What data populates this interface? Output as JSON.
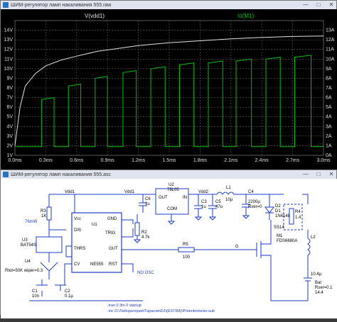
{
  "plot_window": {
    "title": "ШИМ-регулятор ламп накаливания 555.raw",
    "controls": [
      "—",
      "□",
      "✕"
    ],
    "trace_labels": [
      "V(vdd1)",
      "Id(M1)"
    ],
    "colors": {
      "v_trace": "#e0e0e0",
      "i_trace": "#00c000",
      "background": "#000000",
      "grid": "#5a5a5a"
    }
  },
  "chart_data": {
    "type": "line",
    "x_ticks": [
      "0.0ms",
      "0.3ms",
      "0.6ms",
      "0.9ms",
      "1.2ms",
      "1.5ms",
      "1.8ms",
      "2.1ms",
      "2.4ms",
      "2.7ms",
      "3.0ms"
    ],
    "y_left_ticks": [
      "14V",
      "13V",
      "12V",
      "11V",
      "10V",
      "9V",
      "8V",
      "7V",
      "6V",
      "5V",
      "4V",
      "3V",
      "2V",
      "1V"
    ],
    "y_right_ticks": [
      "13A",
      "12A",
      "11A",
      "10A",
      "9A",
      "8A",
      "7A",
      "6A",
      "5A",
      "4A",
      "3A",
      "2A",
      "1A",
      "0A"
    ],
    "x_range_ms": [
      0,
      3.0
    ],
    "y_left_range_v": [
      1,
      14
    ],
    "y_right_range_a": [
      0,
      13
    ],
    "grid": true,
    "series": [
      {
        "name": "V(vdd1)",
        "axis": "left",
        "points": [
          [
            0,
            2
          ],
          [
            0.05,
            6
          ],
          [
            0.1,
            8.2
          ],
          [
            0.2,
            9.5
          ],
          [
            0.3,
            10.3
          ],
          [
            0.45,
            10.9
          ],
          [
            0.6,
            11.3
          ],
          [
            0.8,
            11.8
          ],
          [
            1.0,
            12.1
          ],
          [
            1.2,
            12.4
          ],
          [
            1.5,
            12.7
          ],
          [
            1.8,
            12.9
          ],
          [
            2.1,
            13.1
          ],
          [
            2.4,
            13.25
          ],
          [
            2.7,
            13.35
          ],
          [
            3.0,
            13.4
          ]
        ]
      },
      {
        "name": "Id(M1)",
        "axis": "right",
        "pulses": [
          [
            0.26,
            0.38,
            5.8
          ],
          [
            0.52,
            0.64,
            7.2
          ],
          [
            0.78,
            0.9,
            8.0
          ],
          [
            1.05,
            1.18,
            8.6
          ],
          [
            1.32,
            1.46,
            9.0
          ],
          [
            1.6,
            1.74,
            9.4
          ],
          [
            1.88,
            2.02,
            9.6
          ],
          [
            2.15,
            2.3,
            9.8
          ],
          [
            2.44,
            2.58,
            10.0
          ],
          [
            2.72,
            2.88,
            10.2
          ]
        ],
        "baseline": 0.9
      }
    ]
  },
  "schem_window": {
    "title": "ШИМ-регулятор ламп накаливания 555.asc",
    "controls": [
      "—",
      "□",
      "✕"
    ]
  },
  "schematic": {
    "net_vdd1": "Vdd1",
    "net_vdd2": "Vdd2",
    "r3": {
      "name": "R3",
      "value": "1K"
    },
    "r3_note": "76mW",
    "u3": {
      "name": "U3",
      "part": "BAT54S"
    },
    "rtrim": "Rtot=50K wiper=0.3",
    "u4": "U4",
    "u1": {
      "name": "U1",
      "part": "NE555"
    },
    "u1_pins": {
      "vcc": "Vcc",
      "gnd": "GND",
      "dis": "DIS",
      "trig": "TRIG",
      "thrs": "THRS",
      "out": "OUT",
      "cv": "CV",
      "rst": "RST"
    },
    "c6": {
      "name": "C6",
      "value": "1u"
    },
    "r2": {
      "name": "R2",
      "value": "4.7k"
    },
    "u2": {
      "name": "U2",
      "part": "78L05",
      "out": "OUT",
      "in": "IN",
      "com": "COM"
    },
    "c3": {
      "name": "C3",
      "value": "1u"
    },
    "c5": {
      "name": "C5",
      "value": "47u"
    },
    "l1": {
      "name": "L1",
      "value": "10µ"
    },
    "c4": {
      "name": "C4",
      "value": "2200µ"
    },
    "c4_esr": "Rser=0",
    "d1": {
      "name": "D1",
      "value": "1N4148"
    },
    "d2": {
      "name": "D2"
    },
    "r4": {
      "name": "R4",
      "value": "1.4"
    },
    "r5": {
      "name": "R5",
      "value": "100"
    },
    "net_g": "G",
    "m1": {
      "name": "M1",
      "part": "FDS6680A"
    },
    "ss14": "SS14",
    "l2": "L2",
    "no_osc": "NO OSC",
    "c1": {
      "name": "C1",
      "value": "10n"
    },
    "c2": {
      "name": "C2",
      "value": "0.1µ"
    },
    "bat": {
      "name": "Bat",
      "rser": "Rser=0.1",
      "value": "14.4"
    },
    "l2_val": "10.4µ",
    "directives": [
      ".tran 0 3m 0 startup",
      ".inc D:\\Лаборатория\\Тарасов\\DJ\\(EXTRA)\\Potentiometer.sub"
    ]
  }
}
